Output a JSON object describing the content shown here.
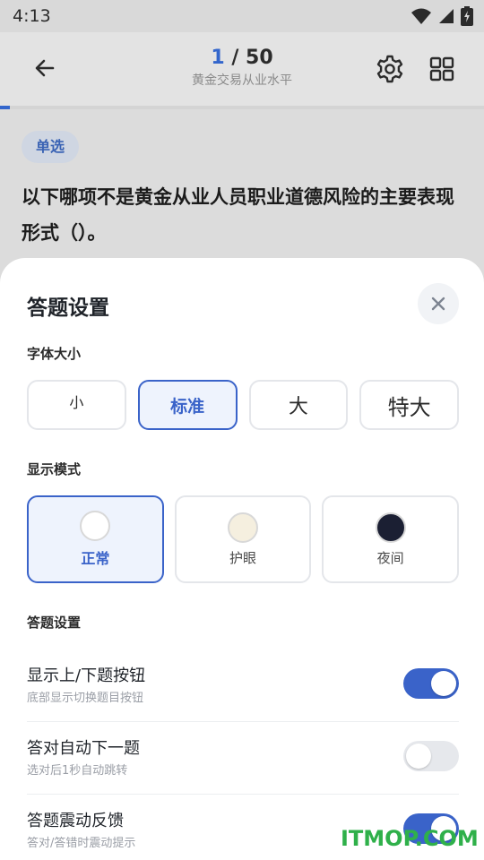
{
  "status_bar": {
    "time": "4:13"
  },
  "header": {
    "progress_current": "1",
    "progress_separator": " / ",
    "progress_total": "50",
    "subtitle": "黄金交易从业水平"
  },
  "progress_fraction": 0.02,
  "question": {
    "type": "单选",
    "text": "以下哪项不是黄金从业人员职业道德风险的主要表现形式（）。"
  },
  "sheet": {
    "title": "答题设置",
    "font_section_label": "字体大小",
    "font_options": [
      {
        "label": "小",
        "selected": false
      },
      {
        "label": "标准",
        "selected": true
      },
      {
        "label": "大",
        "selected": false
      },
      {
        "label": "特大",
        "selected": false
      }
    ],
    "mode_section_label": "显示模式",
    "mode_options": [
      {
        "label": "正常",
        "swatch": "#ffffff",
        "selected": true
      },
      {
        "label": "护眼",
        "swatch": "#f5efdf",
        "selected": false
      },
      {
        "label": "夜间",
        "swatch": "#1b1f33",
        "selected": false
      }
    ],
    "answer_section_label": "答题设置",
    "toggles": [
      {
        "title": "显示上/下题按钮",
        "desc": "底部显示切换题目按钮",
        "on": true
      },
      {
        "title": "答对自动下一题",
        "desc": "选对后1秒自动跳转",
        "on": false
      },
      {
        "title": "答题震动反馈",
        "desc": "答对/答错时震动提示",
        "on": true
      }
    ]
  },
  "watermark": "ITMOP.COM",
  "colors": {
    "accent": "#3a63c9",
    "watermark": "#2fb04a"
  }
}
